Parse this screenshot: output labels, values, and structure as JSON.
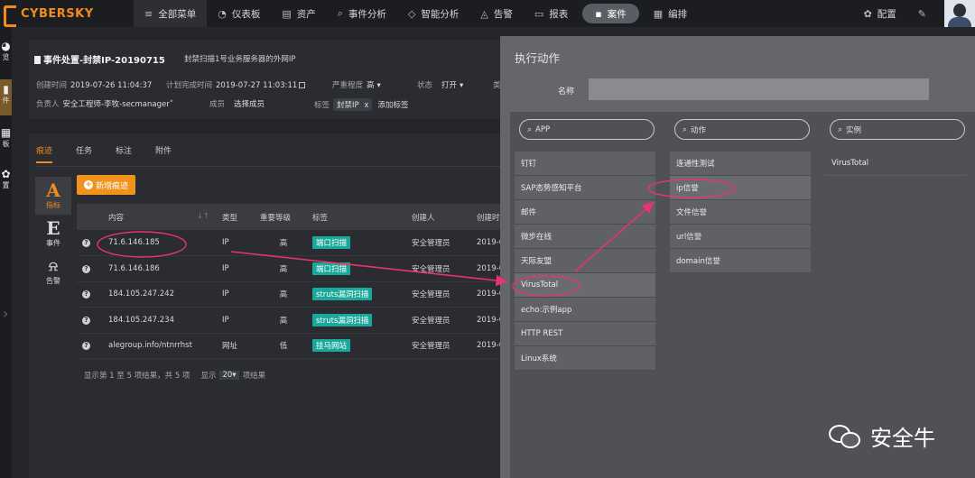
{
  "topnav": {
    "logo_text": "CYBERSKY",
    "items": [
      {
        "icon": "≡",
        "label": "全部菜单"
      },
      {
        "icon": "◔",
        "label": "仪表板"
      },
      {
        "icon": "▤",
        "label": "资产"
      },
      {
        "icon": "⌕",
        "label": "事件分析"
      },
      {
        "icon": "◇",
        "label": "智能分析"
      },
      {
        "icon": "◬",
        "label": "告警"
      },
      {
        "icon": "▭",
        "label": "报表"
      },
      {
        "icon": "▪",
        "label": "案件"
      },
      {
        "icon": "▦",
        "label": "编排"
      }
    ],
    "settings_label": "配置",
    "settings_icon": "✿",
    "wrench_icon": "✎"
  },
  "rail": {
    "items": [
      {
        "icon": "◕",
        "label": "览"
      },
      {
        "icon": "▮",
        "label": "件"
      },
      {
        "icon": "▦",
        "label": "板"
      },
      {
        "icon": "✿",
        "label": "置"
      }
    ],
    "arrow": "›"
  },
  "incident": {
    "title": "事件处置-封禁IP-20190715",
    "description": "封禁扫描1号业务服务器的外网IP",
    "created_label": "创建时间",
    "created_value": "2019-07-26 11:04:37",
    "plan_label": "计划完成时间",
    "plan_value": "2019-07-27 11:03:11",
    "severity_label": "严重程度",
    "severity_value": "高",
    "status_label": "状态",
    "status_value": "打开",
    "truncated_label": "类",
    "owner_label": "负责人",
    "owner_value": "安全工程师-李牧-secmanager",
    "members_label": "成员",
    "members_value": "选择成员",
    "tag_label": "标签",
    "tag_value": "封禁IP",
    "tag_close": "x",
    "add_tag": "添加标签"
  },
  "main": {
    "tabs": [
      "痕迹",
      "任务",
      "标注",
      "附件"
    ],
    "side_tools": [
      {
        "big": "A",
        "label": "指标"
      },
      {
        "big": "E",
        "label": "事件"
      },
      {
        "big": "⍾",
        "label": "告警"
      }
    ],
    "new_button": "新增痕迹",
    "columns": [
      "内容",
      "类型",
      "重要等级",
      "标签",
      "创建人",
      "创建时"
    ],
    "rows": [
      {
        "content": "71.6.146.185",
        "type": "IP",
        "level": "高",
        "tag": "端口扫描",
        "creator": "安全管理员",
        "time": "2019-0"
      },
      {
        "content": "71.6.146.186",
        "type": "IP",
        "level": "高",
        "tag": "端口扫描",
        "creator": "安全管理员",
        "time": "2019-0"
      },
      {
        "content": "184.105.247.242",
        "type": "IP",
        "level": "高",
        "tag": "struts漏洞扫描",
        "creator": "安全管理员",
        "time": "2019-0"
      },
      {
        "content": "184.105.247.234",
        "type": "IP",
        "level": "高",
        "tag": "struts漏洞扫描",
        "creator": "安全管理员",
        "time": "2019-0"
      },
      {
        "content": "alegroup.info/ntnrrhst",
        "type": "网址",
        "level": "低",
        "tag": "挂马网站",
        "creator": "安全管理员",
        "time": "2019-0"
      }
    ],
    "footer_text": "显示第 1 至 5 项结果，共 5 项",
    "page_size_label": "显示",
    "page_size_value": "20",
    "page_size_suffix": "项结果"
  },
  "exec_panel": {
    "title": "执行动作",
    "name_label": "名称",
    "name_value": "",
    "app_search_placeholder": "APP",
    "action_search_placeholder": "动作",
    "instance_search_placeholder": "实例",
    "apps": [
      "钉钉",
      "SAP态势感知平台",
      "邮件",
      "微步在线",
      "天际友盟",
      "VirusTotal",
      "echo:示例app",
      "HTTP REST",
      "Linux系统"
    ],
    "actions": [
      "连通性测试",
      "ip信誉",
      "文件信誉",
      "url信誉",
      "domain信誉"
    ],
    "instances": [
      "VirusTotal"
    ]
  },
  "annotation_color": "#e8336d",
  "watermark": {
    "text": "安全牛"
  }
}
